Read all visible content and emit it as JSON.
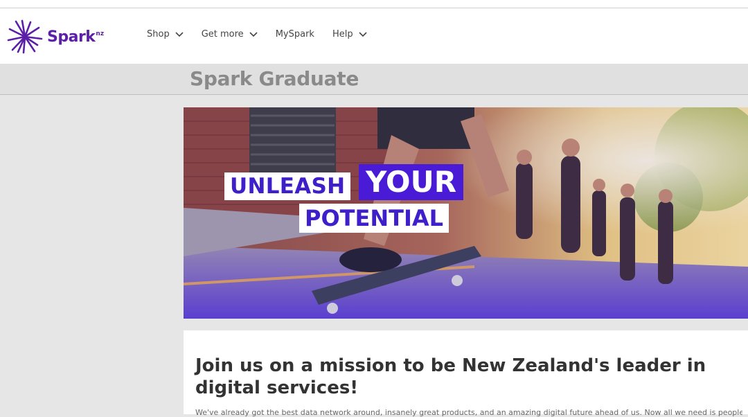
{
  "header": {
    "brand": "Spark",
    "brand_sup": "nz",
    "nav": [
      {
        "label": "Shop",
        "has_dropdown": true
      },
      {
        "label": "Get more",
        "has_dropdown": true
      },
      {
        "label": "MySpark",
        "has_dropdown": false
      },
      {
        "label": "Help",
        "has_dropdown": true
      }
    ]
  },
  "page": {
    "title": "Spark Graduate"
  },
  "hero": {
    "line1": "UNLEASH",
    "line2": "YOUR",
    "line3": "POTENTIAL"
  },
  "content": {
    "headline": "Join us on a mission to be New Zealand's leader in digital services!",
    "body": "We've already got the best data network around, insanely great products, and an amazing digital future ahead of us. Now all we need is people"
  },
  "colors": {
    "brand_purple": "#5b1fa8",
    "hero_blue": "#4a1bd6",
    "title_gray": "#8a8a8a"
  }
}
